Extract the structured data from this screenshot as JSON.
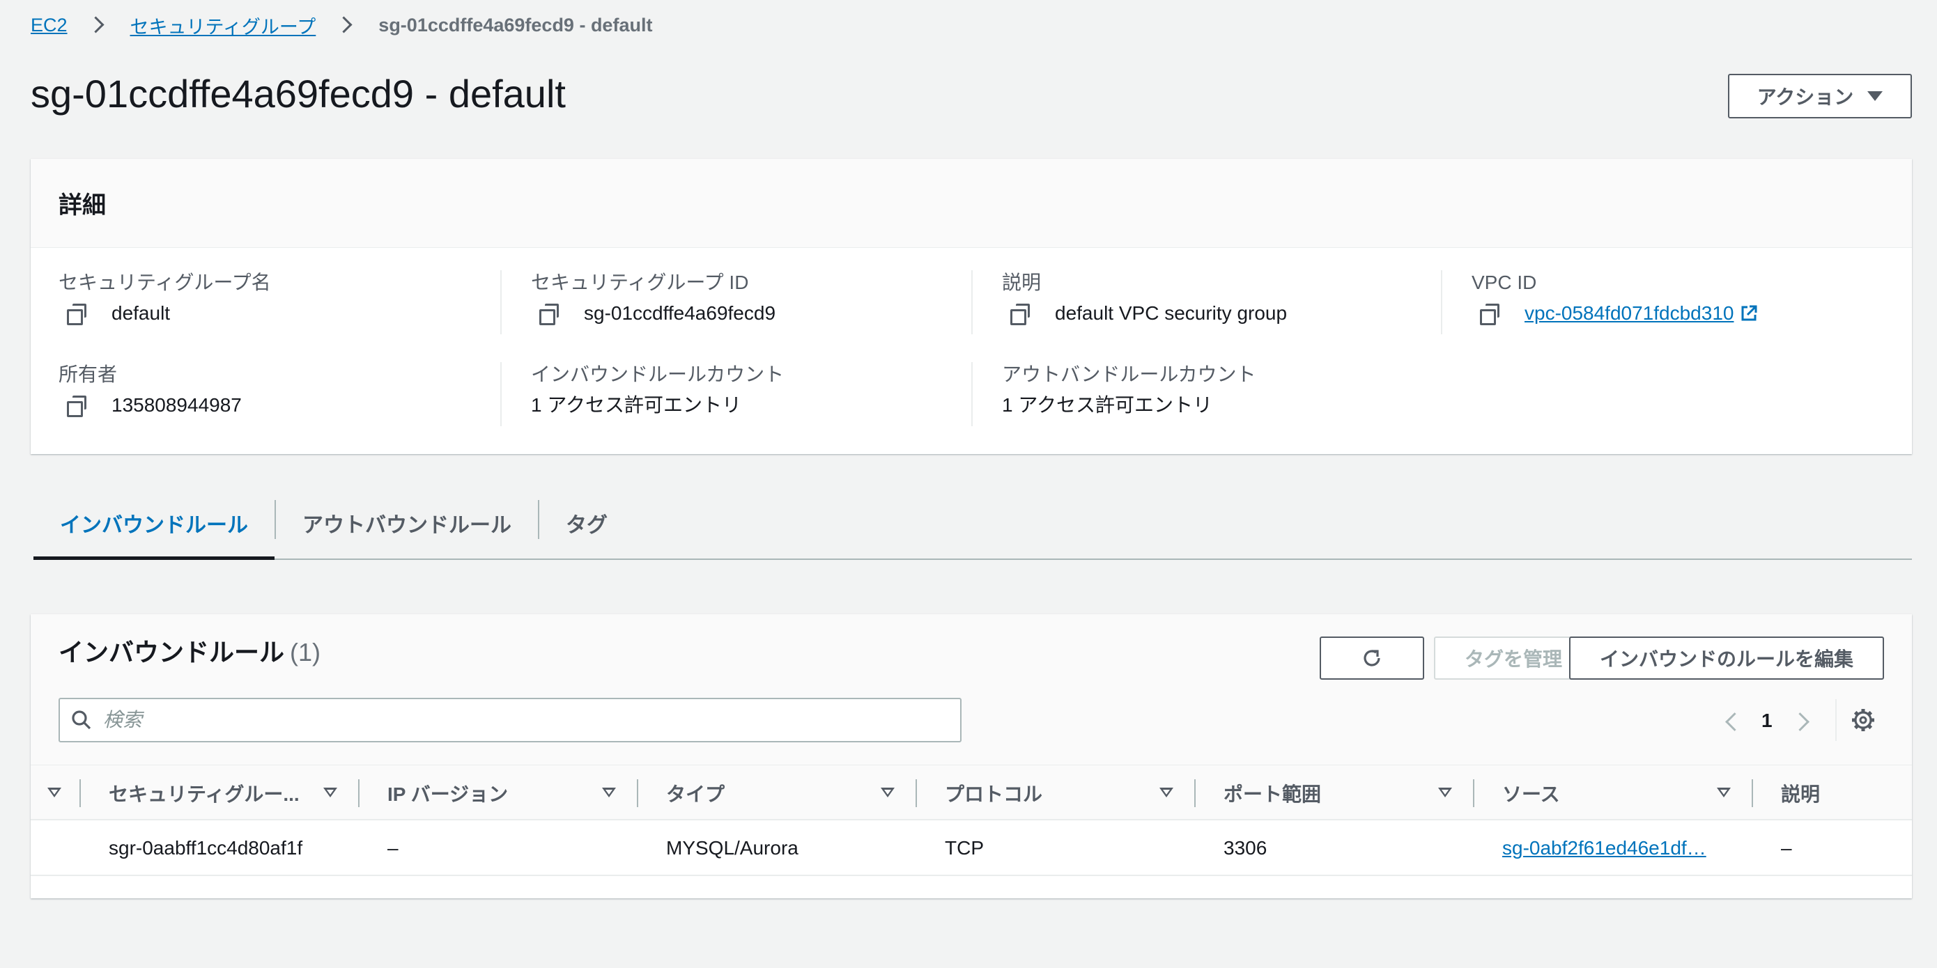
{
  "breadcrumb": {
    "ec2": "EC2",
    "security_groups": "セキュリティグループ",
    "current": "sg-01ccdffe4a69fecd9 - default"
  },
  "header": {
    "title": "sg-01ccdffe4a69fecd9 - default",
    "actions_label": "アクション"
  },
  "details": {
    "heading": "詳細",
    "fields": [
      {
        "label": "セキュリティグループ名",
        "value": "default"
      },
      {
        "label": "セキュリティグループ ID",
        "value": "sg-01ccdffe4a69fecd9"
      },
      {
        "label": "説明",
        "value": "default VPC security group"
      },
      {
        "label": "VPC ID",
        "value": "vpc-0584fd071fdcbd310"
      },
      {
        "label": "所有者",
        "value": "135808944987"
      },
      {
        "label": "インバウンドルールカウント",
        "value": "1 アクセス許可エントリ"
      },
      {
        "label": "アウトバンドルールカウント",
        "value": "1 アクセス許可エントリ"
      }
    ]
  },
  "tabs": [
    {
      "label": "インバウンドルール",
      "active": true
    },
    {
      "label": "アウトバウンドルール",
      "active": false
    },
    {
      "label": "タグ",
      "active": false
    }
  ],
  "inbound": {
    "title": "インバウンドルール",
    "count": "(1)",
    "manage_tags_label": "タグを管理",
    "edit_rules_label": "インバウンドのルールを編集",
    "search_placeholder": "検索",
    "page": "1",
    "columns": [
      "セキュリティグルー...",
      "IP バージョン",
      "タイプ",
      "プロトコル",
      "ポート範囲",
      "ソース",
      "説明"
    ],
    "rows": [
      {
        "rule_id": "sgr-0aabff1cc4d80af1f",
        "ip_version": "–",
        "type": "MYSQL/Aurora",
        "protocol": "TCP",
        "port_range": "3306",
        "source": "sg-0abf2f61ed46e1df…",
        "description": "–"
      }
    ]
  },
  "colors": {
    "link": "#0073bb",
    "background": "#f2f3f3",
    "text": "#16191f",
    "secondary_text": "#545b64"
  }
}
